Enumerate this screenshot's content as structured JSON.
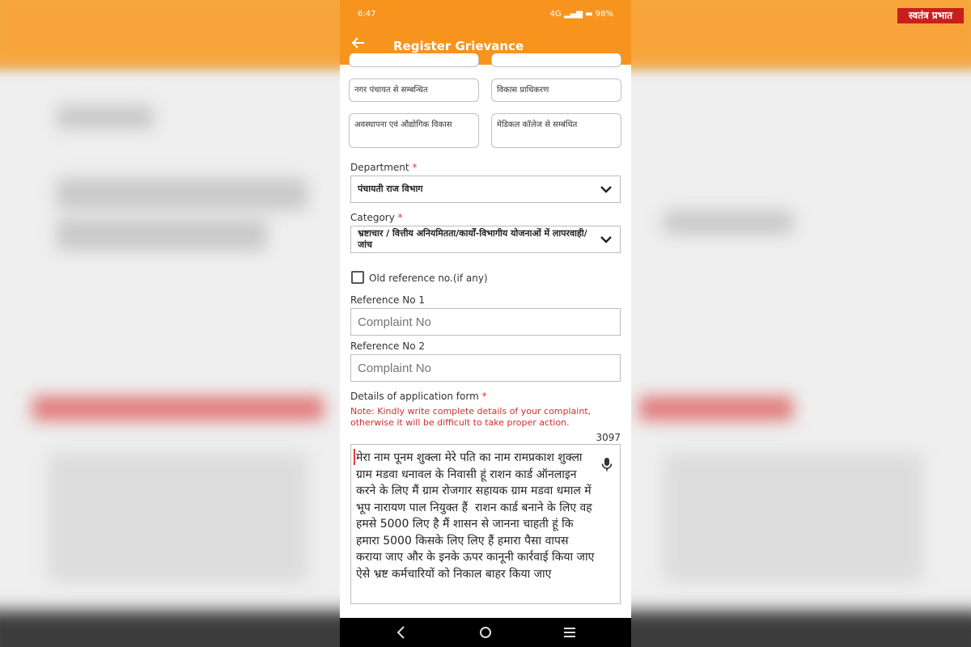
{
  "logo": {
    "text": "स्वतंत्र प्रभात"
  },
  "status_bar": {
    "time": "6:47",
    "network": "4G",
    "battery": "98%"
  },
  "appbar": {
    "title": "Register Grievance"
  },
  "chips": [
    {
      "label": "नगर पंचायत से सम्बन्धित"
    },
    {
      "label": "विकास प्राधिकरण"
    },
    {
      "label": "अवस्थापना एवं औद्योगिक विकास"
    },
    {
      "label": "मेडिकल कॉलेज से सम्बंधित"
    }
  ],
  "department": {
    "label": "Department",
    "required_mark": "*",
    "value": "पंचायती राज  विभाग"
  },
  "category": {
    "label": "Category",
    "required_mark": "*",
    "value": "भ्रष्टाचार / वित्तीय अनियमितता/कार्यों-विभागीय योजनाओं में लापरवाही/जांच"
  },
  "old_reference": {
    "label": "Old reference no.(if any)",
    "checked": false
  },
  "reference1": {
    "label": "Reference No 1",
    "placeholder": "Complaint No"
  },
  "reference2": {
    "label": "Reference No 2",
    "placeholder": "Complaint No"
  },
  "details": {
    "label": "Details of application form",
    "required_mark": "*",
    "note": "Note: Kindly write complete details of your complaint, otherwise it will be difficult to take proper action.",
    "counter": "3097",
    "text": "मेरा नाम पूनम शुक्ला मेरे पति का नाम रामप्रकाश शुक्ला ग्राम मडवा धनावल के निवासी हूं राशन कार्ड ऑनलाइन करने के लिए मैं ग्राम रोजगार सहायक ग्राम मडवा धमाल में भूप नारायण पाल नियुक्त हैं  राशन कार्ड बनाने के लिए वह हमसे 5000 लिए है मैं शासन से जानना चाहती हूं कि हमारा 5000 किसके लिए लिए हैं हमारा पैसा वापस कराया जाए और के इनके ऊपर कानूनी कार्रवाई किया जाए  ऐसे भ्रष्ट कर्मचारियों को निकाल बाहर किया जाए"
  },
  "colors": {
    "appbar": "#f7941d",
    "required": "#e53935",
    "note": "#d32f2f"
  }
}
